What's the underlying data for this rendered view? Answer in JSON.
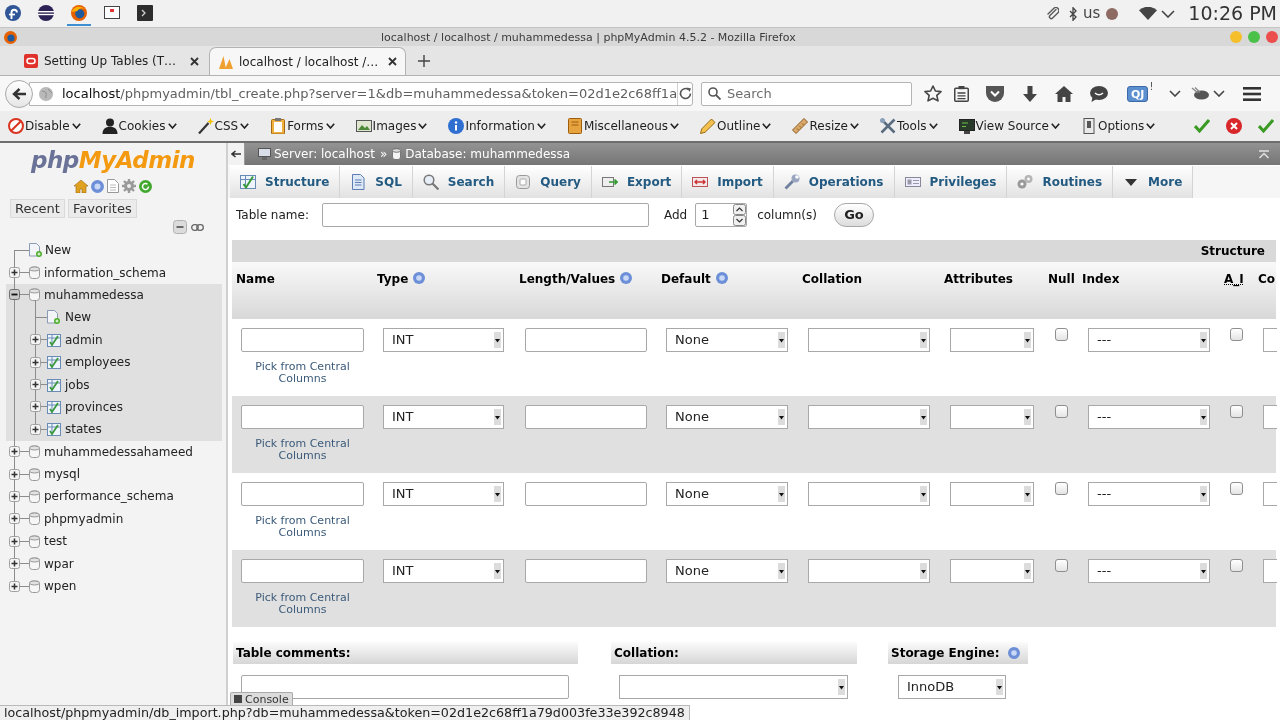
{
  "taskbar": [
    {
      "kind": "logo",
      "focused": false
    },
    {
      "kind": "ide",
      "focused": false
    },
    {
      "kind": "browser",
      "focused": true
    },
    {
      "kind": "display",
      "focused": false
    },
    {
      "kind": "terminal",
      "focused": false
    }
  ],
  "system_tray": {
    "keyboard_layout": "us",
    "clock": "10:26 PM"
  },
  "window": {
    "title": "localhost / localhost / muhammedessa | phpMyAdmin 4.5.2 - Mozilla Firefox"
  },
  "browser_tabs": [
    {
      "label": "Setting Up Tables (T…",
      "selected": false
    },
    {
      "label": "localhost / localhost /…",
      "selected": true
    }
  ],
  "address_bar": {
    "host": "localhost",
    "path": "/phpmyadmin/tbl_create.php?server=1&db=muhammedessa&token=02d1e2c68ff1a"
  },
  "search_field": {
    "placeholder": "Search"
  },
  "extension_badge": {
    "label": "QJ",
    "mark": "!"
  },
  "developer_toolbar": {
    "menus": [
      "Disable",
      "Cookies",
      "CSS",
      "Forms",
      "Images",
      "Information",
      "Miscellaneous",
      "Outline",
      "Resize",
      "Tools",
      "View Source",
      "Options"
    ]
  },
  "sidebar": {
    "logo": [
      "php",
      "MyAdmin"
    ],
    "buttons": [
      "Recent",
      "Favorites"
    ],
    "tree": [
      {
        "label": "New",
        "kind": "new"
      },
      {
        "label": "information_schema",
        "kind": "database",
        "expanded": false
      },
      {
        "label": "muhammedessa",
        "kind": "database",
        "expanded": true,
        "children": [
          {
            "label": "New",
            "kind": "new"
          },
          {
            "label": "admin",
            "kind": "table",
            "expanded": false
          },
          {
            "label": "employees",
            "kind": "table",
            "expanded": false
          },
          {
            "label": "jobs",
            "kind": "table",
            "expanded": false
          },
          {
            "label": "provinces",
            "kind": "table",
            "expanded": false
          },
          {
            "label": "states",
            "kind": "table",
            "expanded": false
          }
        ]
      },
      {
        "label": "muhammedessahameed",
        "kind": "database",
        "expanded": false
      },
      {
        "label": "mysql",
        "kind": "database",
        "expanded": false
      },
      {
        "label": "performance_schema",
        "kind": "database",
        "expanded": false
      },
      {
        "label": "phpmyadmin",
        "kind": "database",
        "expanded": false
      },
      {
        "label": "test",
        "kind": "database",
        "expanded": false
      },
      {
        "label": "wpar",
        "kind": "database",
        "expanded": false
      },
      {
        "label": "wpen",
        "kind": "database",
        "expanded": false
      }
    ]
  },
  "breadcrumb": {
    "server": "Server: localhost",
    "separator": "»",
    "database": "Database: muhammedessa"
  },
  "db_tabs": [
    {
      "label": "Structure",
      "selected": false
    },
    {
      "label": "SQL",
      "selected": false
    },
    {
      "label": "Search",
      "selected": false
    },
    {
      "label": "Query",
      "selected": false
    },
    {
      "label": "Export",
      "selected": false
    },
    {
      "label": "Import",
      "selected": false
    },
    {
      "label": "Operations",
      "selected": false
    },
    {
      "label": "Privileges",
      "selected": false
    },
    {
      "label": "Routines",
      "selected": false
    },
    {
      "label": "More",
      "selected": false
    }
  ],
  "create_form": {
    "table_name_label": "Table name:",
    "add_label": "Add",
    "column_count": "1",
    "columns_label": "column(s)",
    "go_button": "Go"
  },
  "structure_table": {
    "group_heading": "Structure",
    "columns": [
      {
        "label": "Name",
        "help": false,
        "abbreviation": false
      },
      {
        "label": "Type",
        "help": true,
        "abbreviation": false
      },
      {
        "label": "Length/Values",
        "help": true,
        "abbreviation": false
      },
      {
        "label": "Default",
        "help": true,
        "abbreviation": false
      },
      {
        "label": "Collation",
        "help": false,
        "abbreviation": false
      },
      {
        "label": "Attributes",
        "help": false,
        "abbreviation": false
      },
      {
        "label": "Null",
        "help": false,
        "abbreviation": false
      },
      {
        "label": "Index",
        "help": false,
        "abbreviation": false
      },
      {
        "label": "A_I",
        "help": false,
        "abbreviation": true
      },
      {
        "label": "Co",
        "help": false,
        "abbreviation": false
      }
    ],
    "rows": [
      {
        "type": "INT",
        "default": "None",
        "index": "---",
        "null": false,
        "auto_increment": false,
        "central_columns_link": "Pick from Central Columns"
      },
      {
        "type": "INT",
        "default": "None",
        "index": "---",
        "null": false,
        "auto_increment": false,
        "central_columns_link": "Pick from Central Columns"
      },
      {
        "type": "INT",
        "default": "None",
        "index": "---",
        "null": false,
        "auto_increment": false,
        "central_columns_link": "Pick from Central Columns"
      },
      {
        "type": "INT",
        "default": "None",
        "index": "---",
        "null": false,
        "auto_increment": false,
        "central_columns_link": "Pick from Central Columns"
      }
    ]
  },
  "table_options": {
    "comments_label": "Table comments:",
    "collation_label": "Collation:",
    "engine_label": "Storage Engine:",
    "engine_help": true,
    "engine": "InnoDB"
  },
  "console": {
    "label": "Console"
  },
  "status_url": "localhost/phpmyadmin/db_import.php?db=muhammedessa&token=02d1e2c68ff1a79d003fe33e392c8948"
}
